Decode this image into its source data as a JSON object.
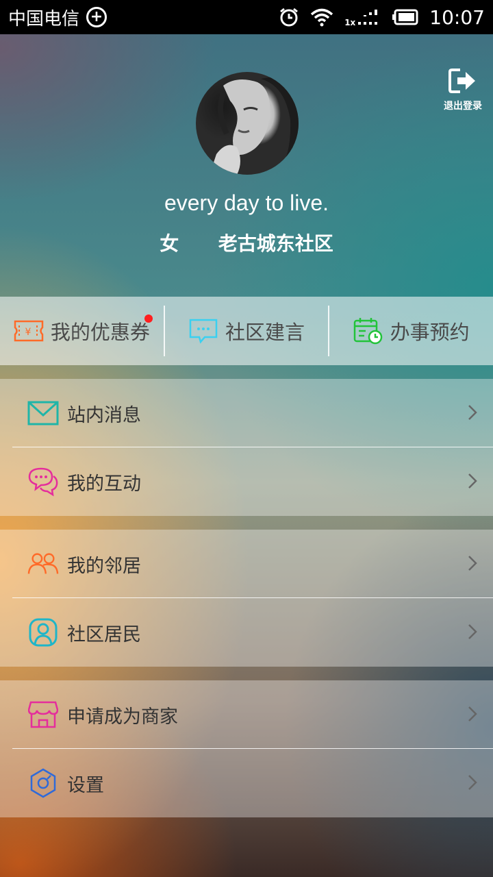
{
  "status_bar": {
    "carrier": "中国电信",
    "network_type": "1x",
    "time": "10:07"
  },
  "header": {
    "logout_label": "退出登录",
    "signature": "every day to live.",
    "gender": "女",
    "community": "老古城东社区"
  },
  "quick_actions": [
    {
      "label": "我的优惠券",
      "icon": "coupon-icon",
      "color": "#ff6a28",
      "has_badge": true
    },
    {
      "label": "社区建言",
      "icon": "chat-bubble-icon",
      "color": "#3ad0f0"
    },
    {
      "label": "办事预约",
      "icon": "calendar-clock-icon",
      "color": "#22c33a"
    }
  ],
  "menu_groups": [
    [
      {
        "label": "站内消息",
        "icon": "mail-icon",
        "color": "#1fb5a8"
      },
      {
        "label": "我的互动",
        "icon": "chat-icon",
        "color": "#e52d9c"
      }
    ],
    [
      {
        "label": "我的邻居",
        "icon": "people-icon",
        "color": "#ff6a28"
      },
      {
        "label": "社区居民",
        "icon": "residents-icon",
        "color": "#1fb5c8"
      }
    ],
    [
      {
        "label": "申请成为商家",
        "icon": "store-icon",
        "color": "#e52d9c"
      },
      {
        "label": "设置",
        "icon": "settings-icon",
        "color": "#2f6ad9"
      }
    ]
  ]
}
